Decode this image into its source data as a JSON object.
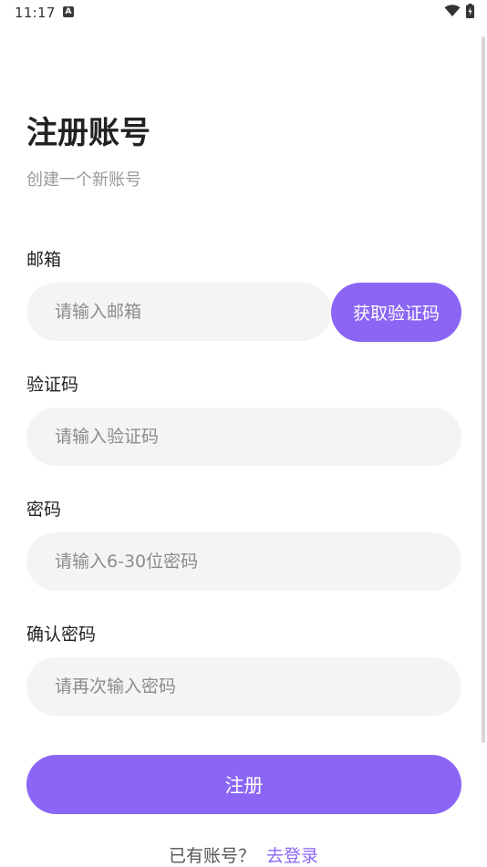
{
  "status_bar": {
    "time": "11:17",
    "notification_glyph": "A"
  },
  "header": {
    "title": "注册账号",
    "subtitle": "创建一个新账号"
  },
  "form": {
    "email": {
      "label": "邮箱",
      "placeholder": "请输入邮箱",
      "value": ""
    },
    "get_code_button": "获取验证码",
    "code": {
      "label": "验证码",
      "placeholder": "请输入验证码",
      "value": ""
    },
    "password": {
      "label": "密码",
      "placeholder": "请输入6-30位密码",
      "value": ""
    },
    "confirm_password": {
      "label": "确认密码",
      "placeholder": "请再次输入密码",
      "value": ""
    },
    "submit_button": "注册"
  },
  "footer": {
    "prompt": "已有账号？",
    "login_link": "去登录"
  },
  "colors": {
    "accent": "#8b66f5",
    "field_background": "#f4f4f4",
    "placeholder": "#8c8c8c",
    "subtitle": "#9a9a9a"
  }
}
